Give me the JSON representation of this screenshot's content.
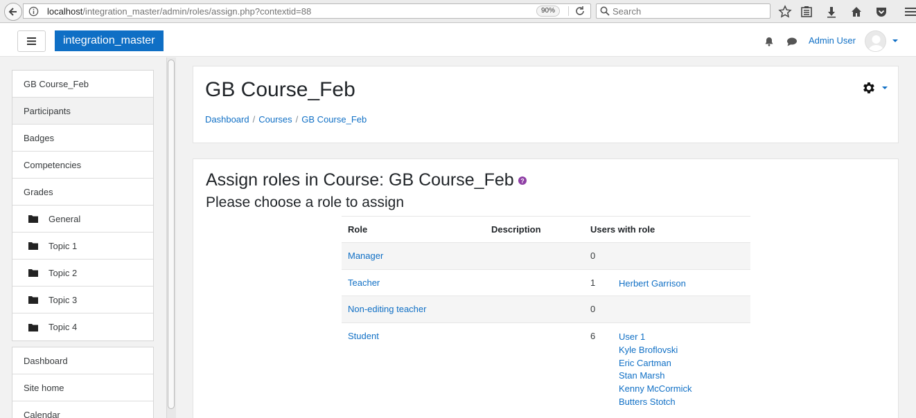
{
  "browser": {
    "url_host": "localhost",
    "url_path": "/integration_master/admin/roles/assign.php?contextid=88",
    "zoom": "90%",
    "search_placeholder": "Search"
  },
  "navbar": {
    "brand": "integration_master",
    "user_name": "Admin User"
  },
  "drawer": {
    "course_items": [
      {
        "label": "GB Course_Feb"
      },
      {
        "label": "Participants"
      },
      {
        "label": "Badges"
      },
      {
        "label": "Competencies"
      },
      {
        "label": "Grades"
      },
      {
        "label": "General"
      },
      {
        "label": "Topic 1"
      },
      {
        "label": "Topic 2"
      },
      {
        "label": "Topic 3"
      },
      {
        "label": "Topic 4"
      }
    ],
    "site_items": [
      {
        "label": "Dashboard"
      },
      {
        "label": "Site home"
      },
      {
        "label": "Calendar"
      }
    ]
  },
  "header": {
    "title": "GB Course_Feb",
    "breadcrumb": [
      "Dashboard",
      "Courses",
      "GB Course_Feb"
    ]
  },
  "main": {
    "heading": "Assign roles in Course: GB Course_Feb",
    "subheading": "Please choose a role to assign",
    "table": {
      "columns": [
        "Role",
        "Description",
        "Users with role"
      ],
      "rows": [
        {
          "role": "Manager",
          "count": "0",
          "users": []
        },
        {
          "role": "Teacher",
          "count": "1",
          "users": [
            "Herbert Garrison"
          ]
        },
        {
          "role": "Non-editing teacher",
          "count": "0",
          "users": []
        },
        {
          "role": "Student",
          "count": "6",
          "users": [
            "User 1",
            "Kyle Broflovski",
            "Eric Cartman",
            "Stan Marsh",
            "Kenny McCormick",
            "Butters Stotch"
          ]
        }
      ]
    }
  }
}
